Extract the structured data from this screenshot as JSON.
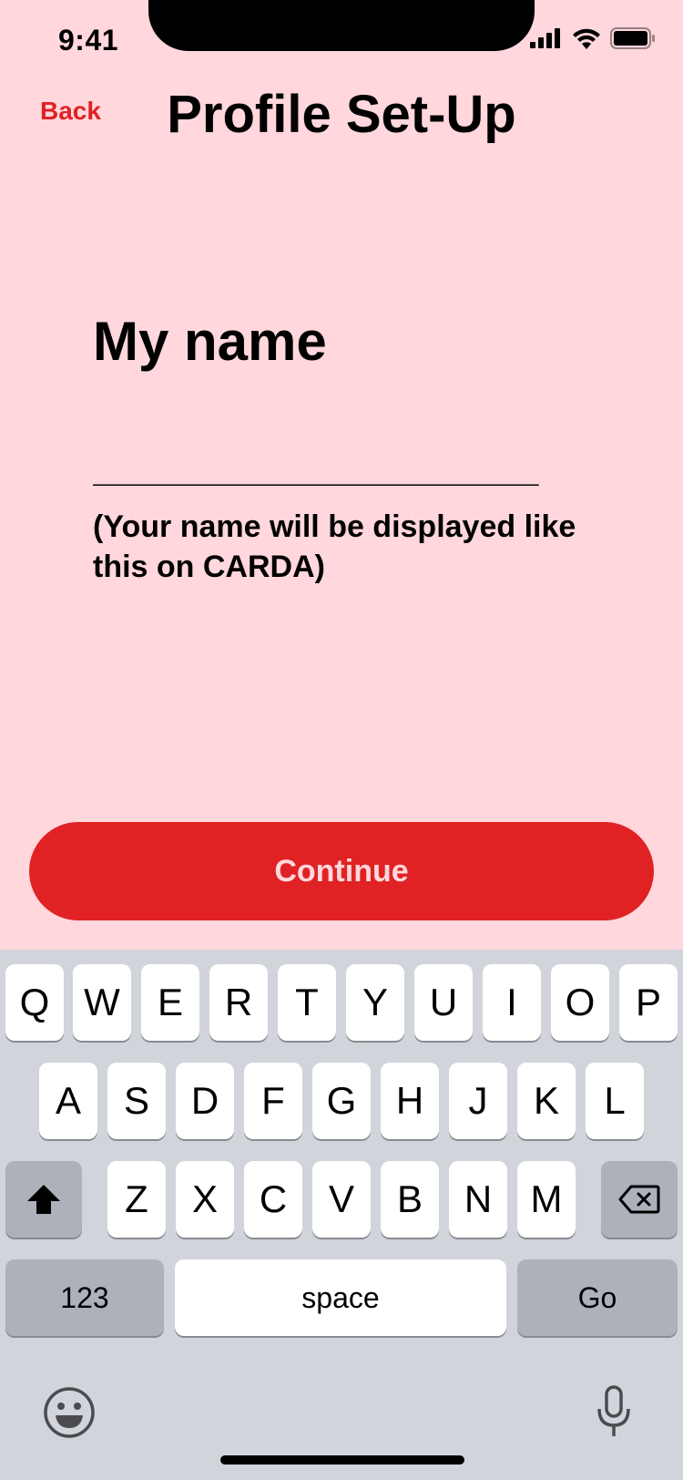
{
  "status": {
    "time": "9:41"
  },
  "nav": {
    "back_label": "Back",
    "title": "Profile Set-Up"
  },
  "form": {
    "label": "My name",
    "placeholder": "______________________",
    "value": "",
    "helper": "(Your name will be displayed like this on CARDA)"
  },
  "actions": {
    "continue_label": "Continue"
  },
  "keyboard": {
    "row1": [
      "Q",
      "W",
      "E",
      "R",
      "T",
      "Y",
      "U",
      "I",
      "O",
      "P"
    ],
    "row2": [
      "A",
      "S",
      "D",
      "F",
      "G",
      "H",
      "J",
      "K",
      "L"
    ],
    "row3": [
      "Z",
      "X",
      "C",
      "V",
      "B",
      "N",
      "M"
    ],
    "numbers_label": "123",
    "space_label": "space",
    "go_label": "Go"
  },
  "colors": {
    "accent": "#e02224",
    "background": "#ffd7dc",
    "keyboard": "#d1d4db"
  }
}
